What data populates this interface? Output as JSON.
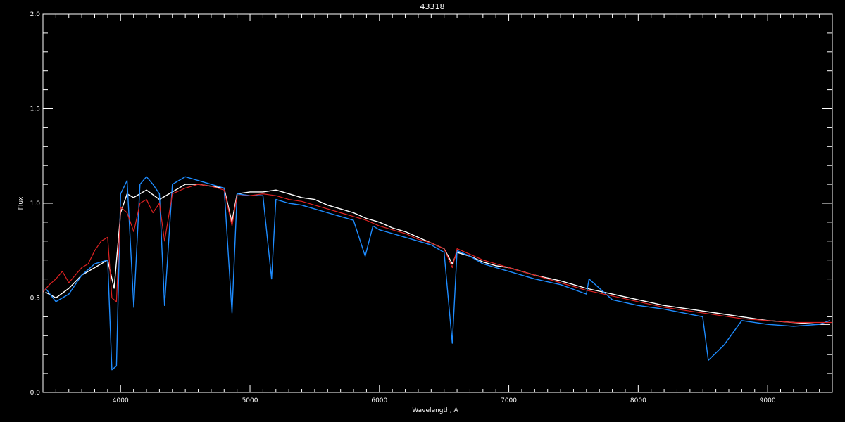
{
  "chart_data": {
    "type": "line",
    "title": "43318",
    "xlabel": "Wavelength, A",
    "ylabel": "Flux",
    "xlim": [
      3400,
      9500
    ],
    "ylim": [
      0.0,
      2.0
    ],
    "x_ticks": [
      4000,
      5000,
      6000,
      7000,
      8000,
      9000
    ],
    "y_ticks": [
      "0.0",
      "0.5",
      "1.0",
      "1.5",
      "2.0"
    ],
    "grid": false,
    "colors": {
      "background": "#000000",
      "axes": "#ffffff",
      "observed_white": "#ffffff",
      "observed_blue": "#1e8cff",
      "model_red": "#dd2222"
    },
    "series": [
      {
        "key": "white",
        "color": "#ffffff",
        "x": [
          3420,
          3500,
          3600,
          3700,
          3800,
          3900,
          3950,
          4000,
          4050,
          4100,
          4200,
          4300,
          4400,
          4500,
          4600,
          4700,
          4800,
          4860,
          4900,
          5000,
          5100,
          5200,
          5300,
          5400,
          5500,
          5600,
          5700,
          5800,
          5900,
          6000,
          6100,
          6200,
          6300,
          6400,
          6500,
          6563,
          6600,
          6700,
          6800,
          6900,
          7000,
          7200,
          7400,
          7600,
          7800,
          8000,
          8200,
          8400,
          8600,
          8800,
          9000,
          9200,
          9400,
          9480
        ],
        "y": [
          0.53,
          0.5,
          0.55,
          0.62,
          0.66,
          0.7,
          0.55,
          0.95,
          1.05,
          1.03,
          1.07,
          1.02,
          1.06,
          1.1,
          1.1,
          1.09,
          1.08,
          0.9,
          1.05,
          1.06,
          1.06,
          1.07,
          1.05,
          1.03,
          1.02,
          0.99,
          0.97,
          0.95,
          0.92,
          0.9,
          0.87,
          0.85,
          0.82,
          0.79,
          0.76,
          0.68,
          0.74,
          0.72,
          0.69,
          0.67,
          0.66,
          0.62,
          0.59,
          0.55,
          0.52,
          0.49,
          0.46,
          0.44,
          0.42,
          0.4,
          0.38,
          0.37,
          0.36,
          0.36
        ]
      },
      {
        "key": "blue",
        "color": "#1e8cff",
        "x": [
          3420,
          3500,
          3600,
          3700,
          3800,
          3900,
          3933,
          3968,
          4000,
          4050,
          4102,
          4150,
          4200,
          4250,
          4300,
          4340,
          4400,
          4500,
          4600,
          4700,
          4800,
          4861,
          4900,
          5000,
          5100,
          5167,
          5200,
          5300,
          5400,
          5500,
          5600,
          5700,
          5800,
          5890,
          5950,
          6000,
          6100,
          6200,
          6300,
          6400,
          6500,
          6563,
          6600,
          6700,
          6800,
          6900,
          7000,
          7200,
          7400,
          7600,
          7620,
          7800,
          8000,
          8200,
          8498,
          8542,
          8662,
          8800,
          9000,
          9200,
          9400,
          9480
        ],
        "y": [
          0.55,
          0.48,
          0.52,
          0.62,
          0.68,
          0.7,
          0.12,
          0.14,
          1.05,
          1.12,
          0.45,
          1.1,
          1.14,
          1.1,
          1.05,
          0.46,
          1.1,
          1.14,
          1.12,
          1.1,
          1.08,
          0.42,
          1.05,
          1.04,
          1.04,
          0.6,
          1.02,
          1.0,
          0.99,
          0.97,
          0.95,
          0.93,
          0.91,
          0.72,
          0.88,
          0.86,
          0.84,
          0.82,
          0.8,
          0.78,
          0.74,
          0.26,
          0.75,
          0.72,
          0.68,
          0.66,
          0.64,
          0.6,
          0.57,
          0.52,
          0.6,
          0.49,
          0.46,
          0.44,
          0.4,
          0.17,
          0.25,
          0.38,
          0.36,
          0.35,
          0.36,
          0.38
        ]
      },
      {
        "key": "red",
        "color": "#dd2222",
        "x": [
          3400,
          3450,
          3500,
          3550,
          3600,
          3650,
          3700,
          3750,
          3800,
          3850,
          3900,
          3933,
          3968,
          4000,
          4050,
          4102,
          4150,
          4200,
          4250,
          4300,
          4340,
          4400,
          4500,
          4600,
          4700,
          4800,
          4861,
          4900,
          5000,
          5100,
          5200,
          5300,
          5400,
          5500,
          5600,
          5700,
          5800,
          5900,
          6000,
          6100,
          6200,
          6300,
          6400,
          6500,
          6563,
          6600,
          6700,
          6800,
          6900,
          7000,
          7200,
          7400,
          7600,
          7800,
          8000,
          8200,
          8400,
          8600,
          8800,
          9000,
          9200,
          9400,
          9500
        ],
        "y": [
          0.53,
          0.57,
          0.6,
          0.64,
          0.58,
          0.62,
          0.66,
          0.68,
          0.75,
          0.8,
          0.82,
          0.5,
          0.48,
          0.98,
          0.95,
          0.85,
          1.0,
          1.02,
          0.95,
          1.0,
          0.8,
          1.05,
          1.08,
          1.1,
          1.09,
          1.07,
          0.88,
          1.04,
          1.04,
          1.05,
          1.04,
          1.02,
          1.01,
          0.99,
          0.97,
          0.95,
          0.93,
          0.91,
          0.88,
          0.86,
          0.84,
          0.81,
          0.79,
          0.76,
          0.66,
          0.76,
          0.73,
          0.7,
          0.68,
          0.66,
          0.62,
          0.58,
          0.54,
          0.51,
          0.48,
          0.45,
          0.43,
          0.41,
          0.39,
          0.38,
          0.37,
          0.37,
          0.37
        ]
      }
    ]
  }
}
